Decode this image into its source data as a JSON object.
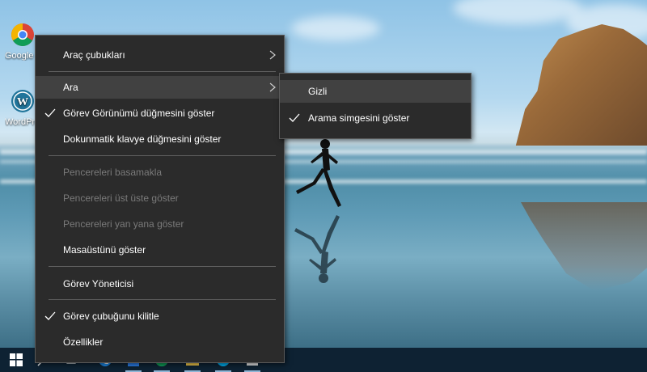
{
  "desktop": {
    "icons": [
      {
        "label": "Google Chrome",
        "icon": "chrome-icon"
      },
      {
        "label": "WordPress",
        "icon": "wordpress-icon"
      }
    ]
  },
  "context_menu": {
    "items": [
      {
        "label": "Araç çubukları",
        "submenu": true
      },
      {
        "label": "Ara",
        "submenu": true,
        "highlighted": true
      },
      {
        "label": "Görev Görünümü düğmesini göster",
        "checked": true
      },
      {
        "label": "Dokunmatik klavye düğmesini göster"
      },
      {
        "label": "Pencereleri basamakla",
        "disabled": true
      },
      {
        "label": "Pencereleri üst üste göster",
        "disabled": true
      },
      {
        "label": "Pencereleri yan yana göster",
        "disabled": true
      },
      {
        "label": "Masaüstünü göster"
      },
      {
        "label": "Görev Yöneticisi"
      },
      {
        "label": "Görev çubuğunu kilitle",
        "checked": true
      },
      {
        "label": "Özellikler"
      }
    ]
  },
  "submenu": {
    "items": [
      {
        "label": "Gizli",
        "highlighted": true
      },
      {
        "label": "Arama simgesini göster",
        "checked": true
      }
    ]
  },
  "taskbar": {
    "start_icon": "windows-logo-icon",
    "pinned": [
      "task-view-icon",
      "edge-icon",
      "store-icon",
      "chrome-icon",
      "explorer-icon",
      "skype-icon",
      "app-icon"
    ]
  },
  "colors": {
    "menu_bg": "#2b2b2b",
    "menu_highlight": "#414141",
    "menu_text": "#ffffff",
    "menu_disabled_text": "#7a7a7a",
    "taskbar_bg": "#0e2233"
  }
}
